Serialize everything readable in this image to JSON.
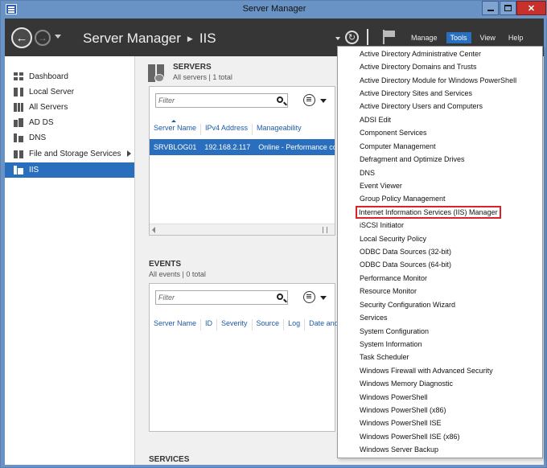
{
  "window": {
    "title": "Server Manager"
  },
  "header": {
    "breadcrumb_root": "Server Manager",
    "breadcrumb_current": "IIS",
    "menus": [
      {
        "label": "Manage",
        "active": false
      },
      {
        "label": "Tools",
        "active": true
      },
      {
        "label": "View",
        "active": false
      },
      {
        "label": "Help",
        "active": false
      }
    ]
  },
  "sidebar": {
    "items": [
      {
        "label": "Dashboard",
        "icon": "dashboard-icon"
      },
      {
        "label": "Local Server",
        "icon": "local-server-icon"
      },
      {
        "label": "All Servers",
        "icon": "all-servers-icon"
      },
      {
        "label": "AD DS",
        "icon": "ad-ds-icon"
      },
      {
        "label": "DNS",
        "icon": "dns-icon"
      },
      {
        "label": "File and Storage Services",
        "icon": "file-storage-icon"
      },
      {
        "label": "IIS",
        "icon": "iis-icon",
        "selected": true
      }
    ]
  },
  "servers": {
    "title": "SERVERS",
    "subtitle": "All servers | 1 total",
    "filter_placeholder": "Filter",
    "columns": [
      "Server Name",
      "IPv4 Address",
      "Manageability"
    ],
    "rows": [
      [
        "SRVBLOG01",
        "192.168.2.117",
        "Online - Performance coun"
      ]
    ]
  },
  "events": {
    "title": "EVENTS",
    "subtitle": "All events | 0 total",
    "filter_placeholder": "Filter",
    "columns": [
      "Server Name",
      "ID",
      "Severity",
      "Source",
      "Log",
      "Date and Tim"
    ]
  },
  "services": {
    "title": "SERVICES"
  },
  "tools_menu": {
    "highlighted": "Internet Information Services (IIS) Manager",
    "items": [
      "Active Directory Administrative Center",
      "Active Directory Domains and Trusts",
      "Active Directory Module for Windows PowerShell",
      "Active Directory Sites and Services",
      "Active Directory Users and Computers",
      "ADSI Edit",
      "Component Services",
      "Computer Management",
      "Defragment and Optimize Drives",
      "DNS",
      "Event Viewer",
      "Group Policy Management",
      "Internet Information Services (IIS) Manager",
      "iSCSI Initiator",
      "Local Security Policy",
      "ODBC Data Sources (32-bit)",
      "ODBC Data Sources (64-bit)",
      "Performance Monitor",
      "Resource Monitor",
      "Security Configuration Wizard",
      "Services",
      "System Configuration",
      "System Information",
      "Task Scheduler",
      "Windows Firewall with Advanced Security",
      "Windows Memory Diagnostic",
      "Windows PowerShell",
      "Windows PowerShell (x86)",
      "Windows PowerShell ISE",
      "Windows PowerShell ISE (x86)",
      "Windows Server Backup"
    ]
  },
  "colors": {
    "accent": "#2a6fbd",
    "header_bg": "#363636",
    "frame": "#6a93c5",
    "highlight_outline": "#d9222a"
  }
}
